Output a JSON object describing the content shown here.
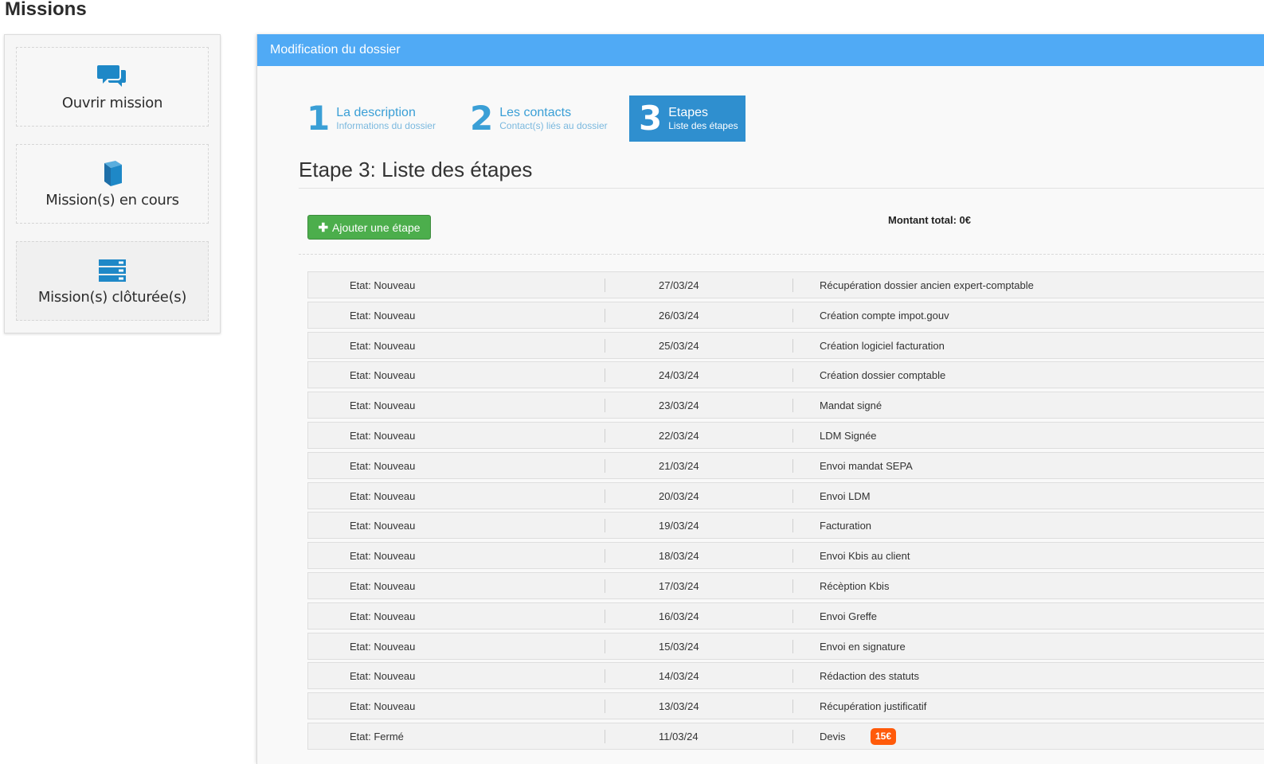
{
  "page": {
    "title": "Missions"
  },
  "sidebar": {
    "items": [
      {
        "label": "Ouvrir mission",
        "icon": "comments-icon"
      },
      {
        "label": "Mission(s) en cours",
        "icon": "book-icon"
      },
      {
        "label": "Mission(s) clôturée(s)",
        "icon": "server-icon"
      }
    ]
  },
  "panel": {
    "header": "Modification du dossier",
    "steps": [
      {
        "num": "1",
        "title": "La description",
        "subtitle": "Informations du dossier",
        "active": false
      },
      {
        "num": "2",
        "title": "Les contacts",
        "subtitle": "Contact(s) liés au dossier",
        "active": false
      },
      {
        "num": "3",
        "title": "Etapes",
        "subtitle": "Liste des étapes",
        "active": true
      }
    ],
    "section_title": "Etape 3: Liste des étapes",
    "add_button": "Ajouter une étape",
    "total": "Montant total: 0€"
  },
  "etapes": [
    {
      "etat": "Etat: Nouveau",
      "date": "27/03/24",
      "description": "Récupération dossier ancien expert-comptable"
    },
    {
      "etat": "Etat: Nouveau",
      "date": "26/03/24",
      "description": "Création compte impot.gouv"
    },
    {
      "etat": "Etat: Nouveau",
      "date": "25/03/24",
      "description": "Création logiciel facturation"
    },
    {
      "etat": "Etat: Nouveau",
      "date": "24/03/24",
      "description": "Création dossier comptable"
    },
    {
      "etat": "Etat: Nouveau",
      "date": "23/03/24",
      "description": "Mandat signé"
    },
    {
      "etat": "Etat: Nouveau",
      "date": "22/03/24",
      "description": "LDM Signée"
    },
    {
      "etat": "Etat: Nouveau",
      "date": "21/03/24",
      "description": "Envoi mandat SEPA"
    },
    {
      "etat": "Etat: Nouveau",
      "date": "20/03/24",
      "description": "Envoi LDM"
    },
    {
      "etat": "Etat: Nouveau",
      "date": "19/03/24",
      "description": "Facturation"
    },
    {
      "etat": "Etat: Nouveau",
      "date": "18/03/24",
      "description": "Envoi Kbis au client"
    },
    {
      "etat": "Etat: Nouveau",
      "date": "17/03/24",
      "description": "Récèption Kbis"
    },
    {
      "etat": "Etat: Nouveau",
      "date": "16/03/24",
      "description": "Envoi Greffe"
    },
    {
      "etat": "Etat: Nouveau",
      "date": "15/03/24",
      "description": "Envoi en signature"
    },
    {
      "etat": "Etat: Nouveau",
      "date": "14/03/24",
      "description": "Rédaction des statuts"
    },
    {
      "etat": "Etat: Nouveau",
      "date": "13/03/24",
      "description": "Récupération justificatif"
    },
    {
      "etat": "Etat: Fermé",
      "date": "11/03/24",
      "description": "Devis",
      "badge": "15€"
    }
  ],
  "colors": {
    "header": "#50aaf5",
    "active_step": "#2f8fcf",
    "step_text": "#3a9fd6",
    "button_green": "#4cae4c",
    "badge": "#ff5a0a",
    "icon": "#1e88c7"
  }
}
